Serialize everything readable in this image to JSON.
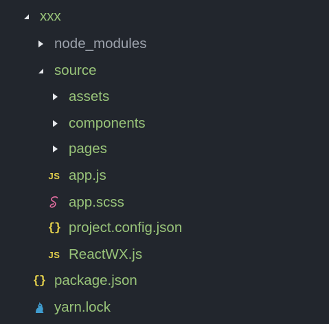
{
  "colors": {
    "background": "#22262d",
    "folder_text": "#98c379",
    "ignored_text": "#9ba1ab",
    "arrow": "#e6e8ec",
    "js_icon": "#e8d44d",
    "json_icon": "#e8d44d",
    "sass_icon": "#e06c9f",
    "yarn_icon": "#3f9ccf"
  },
  "tree": {
    "root": {
      "label": "xxx",
      "expanded": true,
      "icon": "triangle-down-icon"
    },
    "node_modules": {
      "label": "node_modules",
      "expanded": false,
      "icon": "triangle-right-icon"
    },
    "source": {
      "label": "source",
      "expanded": true,
      "icon": "triangle-down-icon"
    },
    "assets": {
      "label": "assets",
      "expanded": false,
      "icon": "triangle-right-icon"
    },
    "components": {
      "label": "components",
      "expanded": false,
      "icon": "triangle-right-icon"
    },
    "pages": {
      "label": "pages",
      "expanded": false,
      "icon": "triangle-right-icon"
    },
    "app_js": {
      "label": "app.js",
      "icon": "js-file-icon",
      "icon_text": "JS"
    },
    "app_scss": {
      "label": "app.scss",
      "icon": "sass-file-icon"
    },
    "project_config": {
      "label": "project.config.json",
      "icon": "json-file-icon",
      "icon_text": "{}"
    },
    "reactwx": {
      "label": "ReactWX.js",
      "icon": "js-file-icon",
      "icon_text": "JS"
    },
    "package_json": {
      "label": "package.json",
      "icon": "json-file-icon",
      "icon_text": "{}"
    },
    "yarn_lock": {
      "label": "yarn.lock",
      "icon": "yarn-file-icon"
    }
  }
}
